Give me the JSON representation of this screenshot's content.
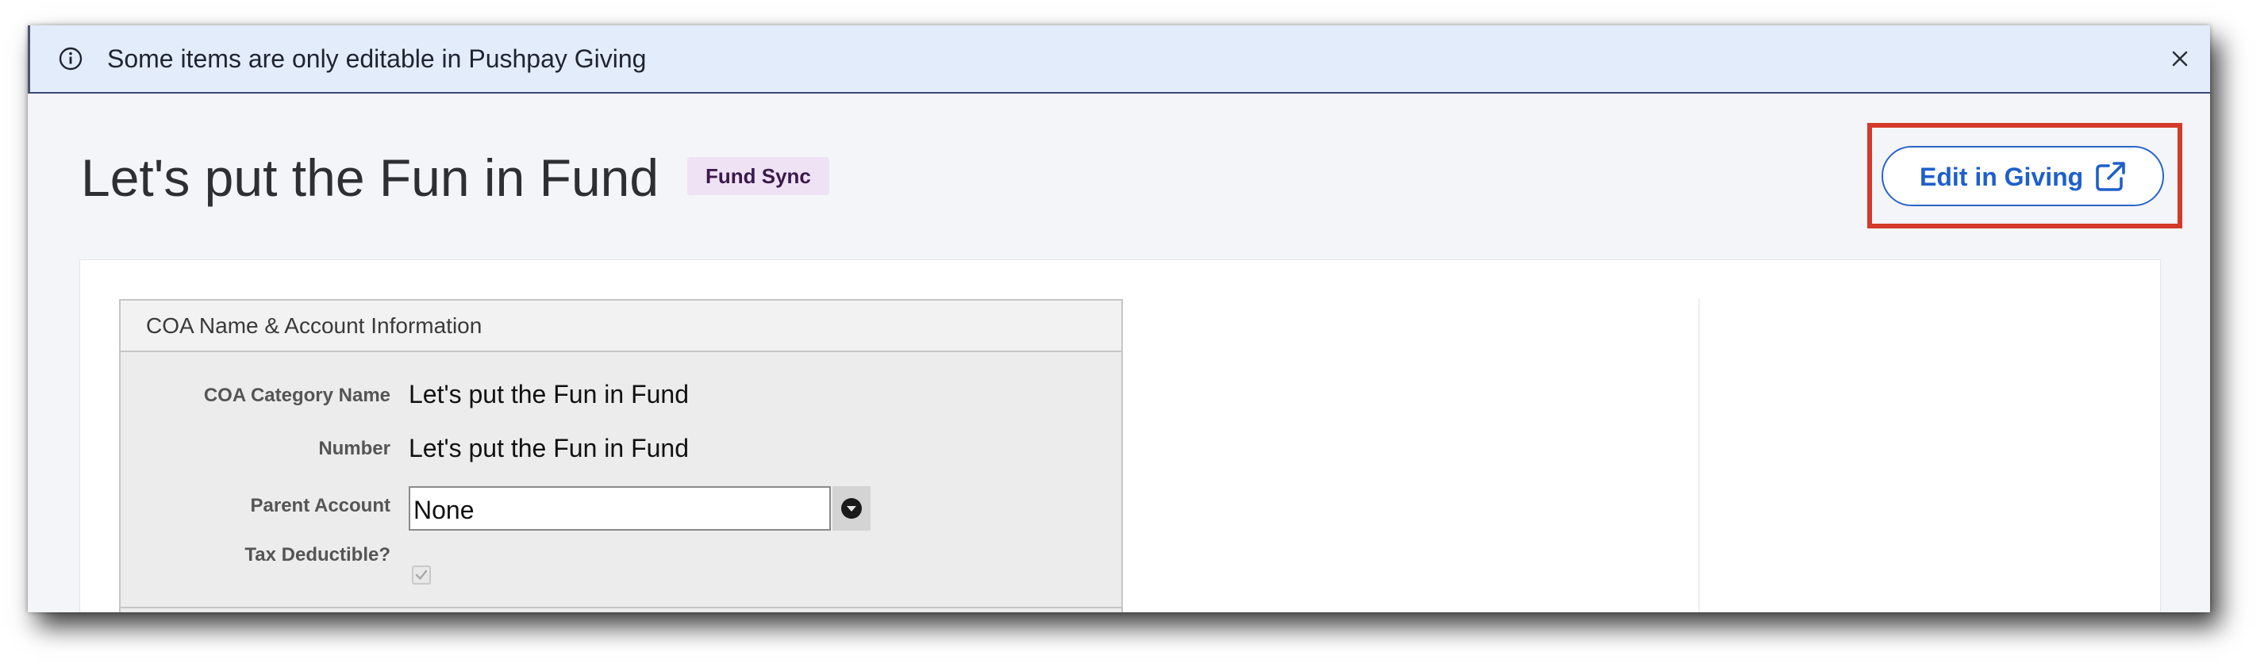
{
  "banner": {
    "message": "Some items are only editable in Pushpay Giving",
    "info_icon": "info-circle-icon",
    "close_icon": "close-icon"
  },
  "header": {
    "title": "Let's put the Fun in Fund",
    "badge": "Fund Sync",
    "edit_button_label": "Edit in Giving",
    "edit_button_icon": "external-link-icon"
  },
  "panel": {
    "title": "COA Name & Account Information",
    "fields": {
      "category_label": "COA Category Name",
      "category_value": "Let's put the Fun in Fund",
      "number_label": "Number",
      "number_value": "Let's put the Fun in Fund",
      "parent_label": "Parent Account",
      "parent_value": "None",
      "tax_label": "Tax Deductible?",
      "tax_checked": true
    }
  },
  "colors": {
    "banner_bg": "#e3ecfb",
    "accent_blue": "#1f5fcc",
    "highlight_red": "#d43a2a",
    "badge_bg": "#efe2f5"
  }
}
